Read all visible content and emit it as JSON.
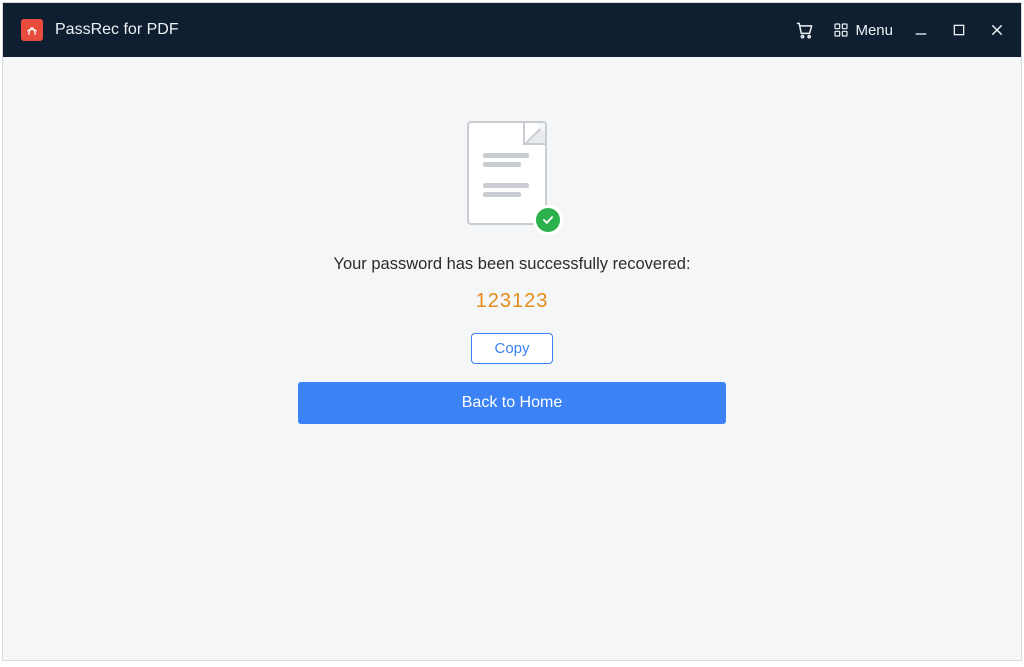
{
  "titlebar": {
    "app_title": "PassRec for PDF",
    "menu_label": "Menu"
  },
  "main": {
    "success_message": "Your password has been successfully recovered:",
    "recovered_password": "123123",
    "copy_label": "Copy",
    "home_label": "Back to Home"
  },
  "colors": {
    "titlebar_bg": "#0f1e31",
    "accent_blue": "#3b82f6",
    "password_orange": "#e48b1a",
    "success_green": "#2bb24c",
    "app_icon_red": "#e74c3c"
  }
}
